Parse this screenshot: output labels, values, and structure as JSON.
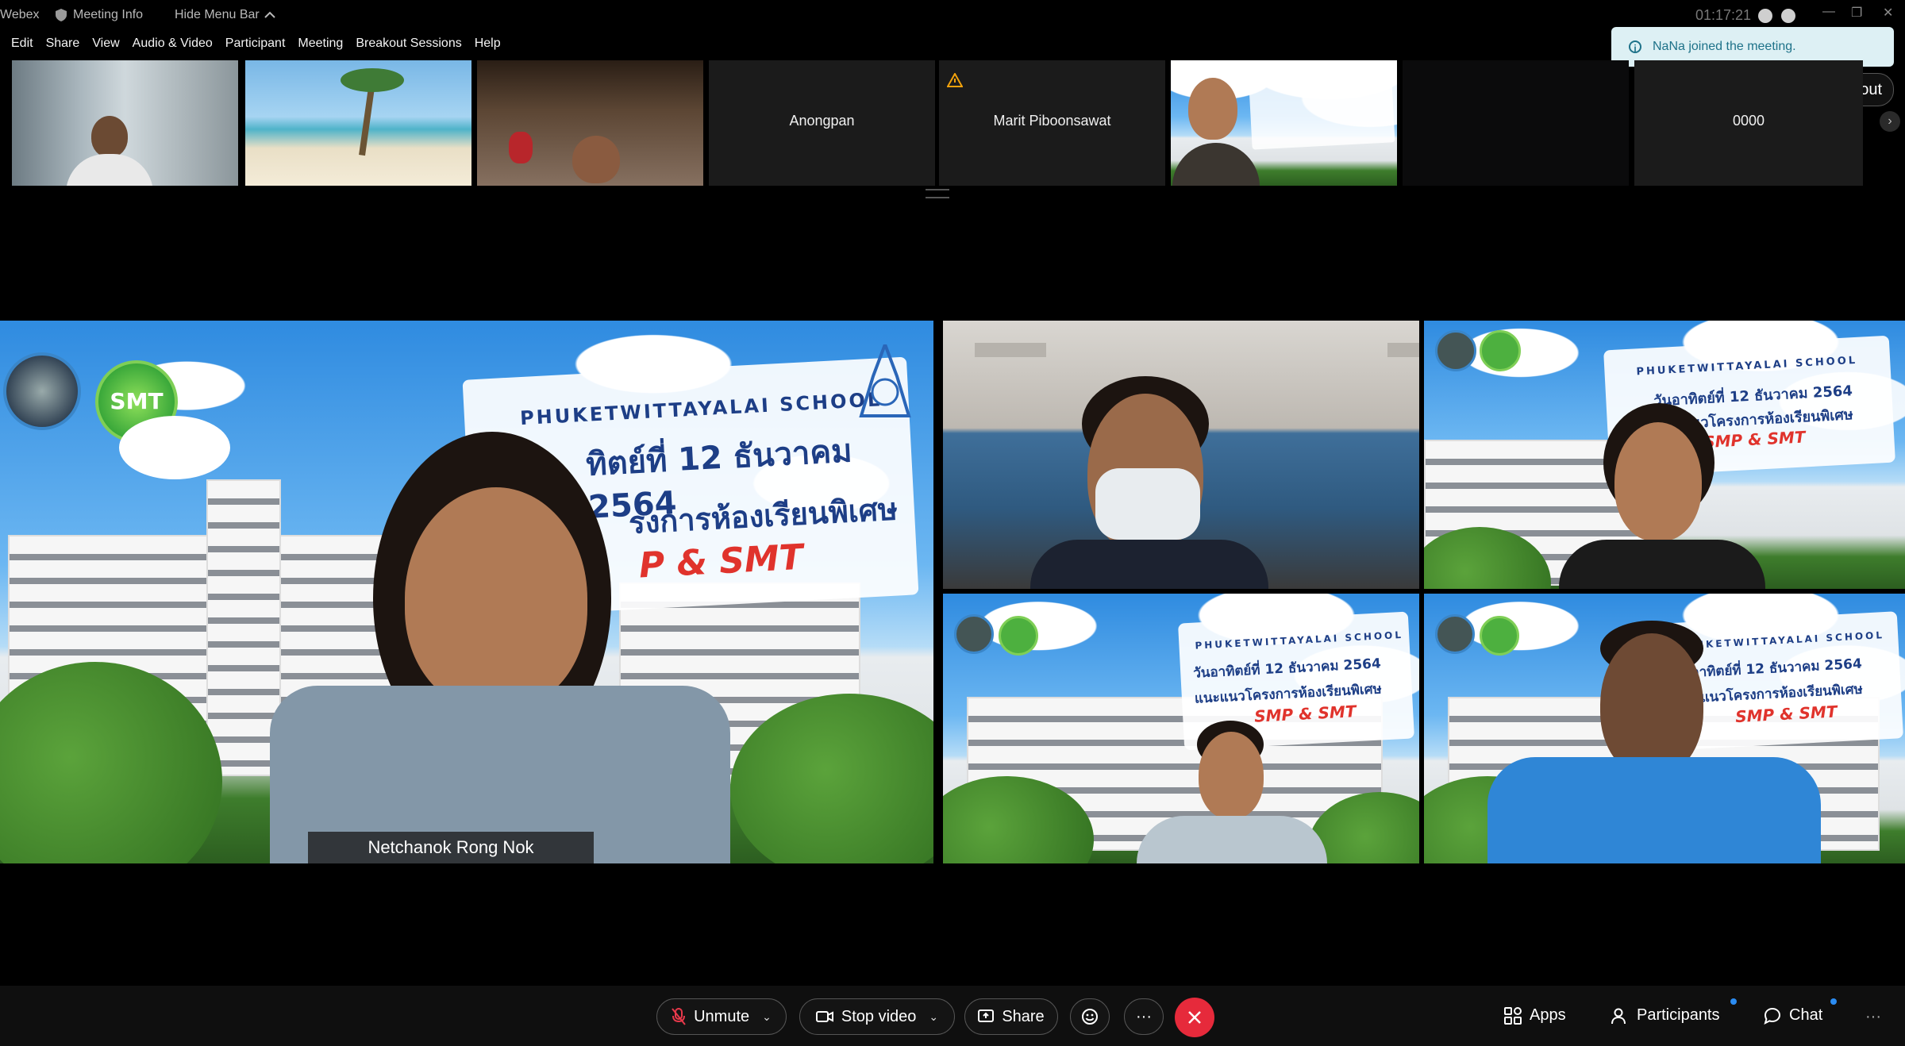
{
  "titlebar": {
    "app_name": "Webex",
    "meeting_info": "Meeting Info",
    "hide_menu_bar": "Hide Menu Bar",
    "clock": "01:17:21"
  },
  "menu": [
    "Edit",
    "Share",
    "View",
    "Audio & Video",
    "Participant",
    "Meeting",
    "Breakout Sessions",
    "Help"
  ],
  "toast": {
    "message": "NaNa joined the meeting."
  },
  "layout_button": "Layout",
  "filmstrip": [
    {
      "name": "",
      "kind": "video"
    },
    {
      "name": "",
      "kind": "beach"
    },
    {
      "name": "",
      "kind": "video"
    },
    {
      "name": "Anongpan",
      "kind": "name"
    },
    {
      "name": "Marit Piboonsawat",
      "kind": "name",
      "warning": true
    },
    {
      "name": "",
      "kind": "video"
    },
    {
      "name": "",
      "kind": "empty"
    },
    {
      "name": "0000",
      "kind": "name"
    }
  ],
  "main": {
    "active_speaker": "Netchanok Rong Nok",
    "banner": {
      "school": "PHUKETWITTAYALAI SCHOOL",
      "line1": "ทิตย์ที่ 12 ธันวาคม 2564",
      "line2": "รงการห้องเรียนพิเศษ",
      "line3": "P & SMT"
    },
    "small_banner": {
      "school": "PHUKETWITTAYALAI SCHOOL",
      "line1": "วันอาทิตย์ที่ 12 ธันวาคม 2564",
      "line2": "แนะแนวโครงการห้องเรียนพิเศษ",
      "line3": "SMP & SMT"
    },
    "logo_text": "SMT"
  },
  "controls": {
    "unmute": "Unmute",
    "stop_video": "Stop video",
    "share": "Share",
    "more": "···",
    "apps": "Apps",
    "participants": "Participants",
    "chat": "Chat"
  }
}
